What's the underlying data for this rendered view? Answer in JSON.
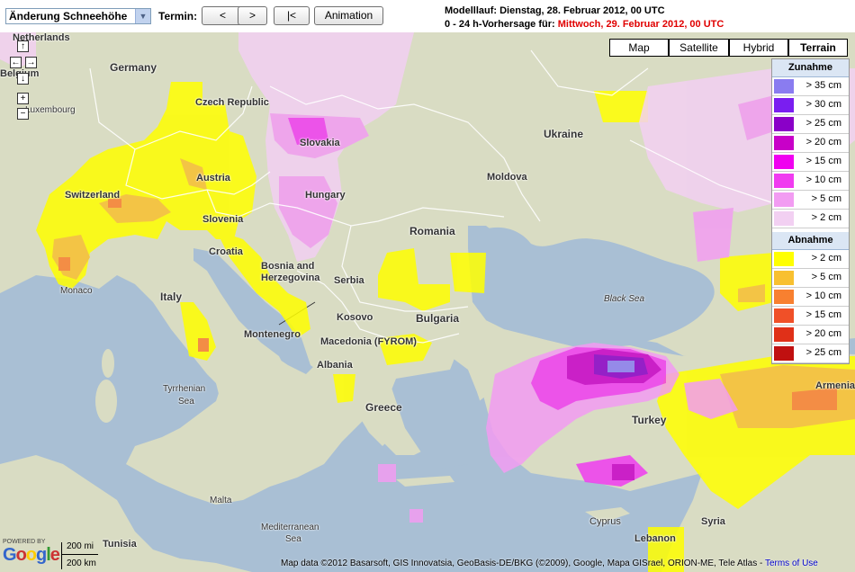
{
  "toolbar": {
    "dropdown_value": "Änderung Schneehöhe",
    "termin_label": "Termin:",
    "prev_button": "<",
    "next_button": ">",
    "first_button": "|<",
    "animation_button": "Animation",
    "run_line": "Modelllauf: Dienstag, 28. Februar 2012, 00 UTC",
    "forecast_prefix": "0 - 24 h-Vorhersage für: ",
    "forecast_date": "Mittwoch, 29. Februar 2012, 00 UTC"
  },
  "map_types": [
    "Map",
    "Satellite",
    "Hybrid",
    "Terrain"
  ],
  "active_map_type": "Terrain",
  "nav": {
    "up": "↑",
    "down": "↓",
    "left": "←",
    "right": "→",
    "zoom_in": "+",
    "zoom_out": "−"
  },
  "legend": {
    "increase_title": "Zunahme",
    "increase": [
      {
        "label": "> 35 cm",
        "color": "#8a7cf0"
      },
      {
        "label": "> 30 cm",
        "color": "#7a1ef0"
      },
      {
        "label": "> 25 cm",
        "color": "#8a00c8"
      },
      {
        "label": "> 20 cm",
        "color": "#c800c8"
      },
      {
        "label": "> 15 cm",
        "color": "#f000f0"
      },
      {
        "label": "> 10 cm",
        "color": "#f03cf0"
      },
      {
        "label": "> 5 cm",
        "color": "#f29cf2"
      },
      {
        "label": "> 2 cm",
        "color": "#f2d0f2"
      }
    ],
    "decrease_title": "Abnahme",
    "decrease": [
      {
        "label": "> 2 cm",
        "color": "#ffff00"
      },
      {
        "label": "> 5 cm",
        "color": "#f8c030"
      },
      {
        "label": "> 10 cm",
        "color": "#f88030"
      },
      {
        "label": "> 15 cm",
        "color": "#f05028"
      },
      {
        "label": "> 20 cm",
        "color": "#e03018"
      },
      {
        "label": "> 25 cm",
        "color": "#c01010"
      }
    ]
  },
  "places": {
    "netherlands": "Netherlands",
    "germany": "Germany",
    "belgium": "Belgium",
    "luxembourg": "Luxembourg",
    "czech": "Czech Republic",
    "slovakia": "Slovakia",
    "austria": "Austria",
    "switzerland": "Switzerland",
    "hungary": "Hungary",
    "slovenia": "Slovenia",
    "croatia": "Croatia",
    "bosnia1": "Bosnia and",
    "bosnia2": "Herzegovina",
    "monaco": "Monaco",
    "italy": "Italy",
    "serbia": "Serbia",
    "romania": "Romania",
    "moldova": "Moldova",
    "ukraine": "Ukraine",
    "kosovo": "Kosovo",
    "bulgaria": "Bulgaria",
    "montenegro": "Montenegro",
    "macedonia": "Macedonia (FYROM)",
    "albania": "Albania",
    "greece": "Greece",
    "turkey": "Turkey",
    "armenia": "Armenia",
    "blacksea": "Black Sea",
    "tyrrhenian1": "Tyrrhenian",
    "tyrrhenian2": "Sea",
    "malta": "Malta",
    "med1": "Mediterranean",
    "med2": "Sea",
    "tunisia": "Tunisia",
    "cyprus": "Cyprus",
    "syria": "Syria",
    "lebanon": "Lebanon"
  },
  "footer": {
    "powered": "POWERED BY",
    "google": "Google",
    "scale_mi": "200 mi",
    "scale_km": "200 km",
    "copyright": "Map data ©2012 Basarsoft, GIS Innovatsia, GeoBasis-DE/BKG (©2009), Google, Mapa GISrael, ORION-ME, Tele Atlas - ",
    "terms": "Terms of Use"
  }
}
